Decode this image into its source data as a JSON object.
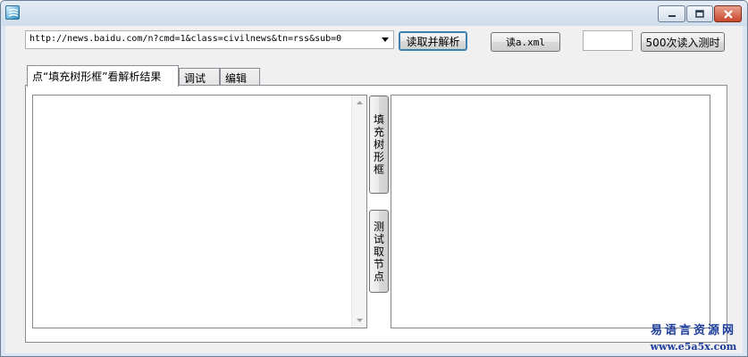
{
  "window": {
    "controls": {
      "minimize": "minimize",
      "maximize": "maximize",
      "close": "close"
    }
  },
  "toolbar": {
    "url_value": "http://news.baidu.com/n?cmd=1&class=civilnews&tn=rss&sub=0",
    "read_parse_label": "读取并解析",
    "read_xml_label": "读a.xml",
    "count_input_value": "",
    "benchmark_label": "500次读入测时"
  },
  "tabs": [
    {
      "label": "点“填充树形框”看解析结果",
      "active": true
    },
    {
      "label": "调试",
      "active": false
    },
    {
      "label": "编辑",
      "active": false
    }
  ],
  "side_buttons": {
    "fill_tree": [
      "填",
      "充",
      "树",
      "形",
      "框"
    ],
    "get_node": [
      "测",
      "试",
      "取",
      "节",
      "点"
    ]
  },
  "watermark": {
    "line1": "易语言资源网",
    "line2": "www.e5a5x.com"
  },
  "colors": {
    "frame": "#dce6f2",
    "client": "#f0f0f0",
    "close_button": "#c9462c",
    "watermark": "#1d3d9a"
  }
}
